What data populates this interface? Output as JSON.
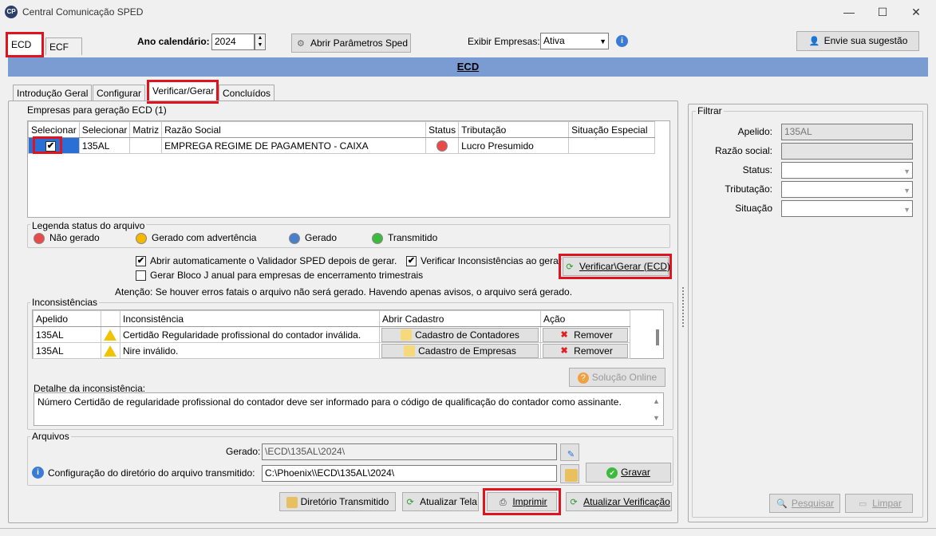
{
  "window": {
    "title": "Central Comunicação SPED",
    "app_icon": "CP",
    "min": "—",
    "max": "☐",
    "close": "✕"
  },
  "top_tabs": [
    {
      "label": "ECD"
    },
    {
      "label": "ECF"
    }
  ],
  "toolbar": {
    "ano_label": "Ano calendário:",
    "ano_value": "2024",
    "abrir_param": "Abrir Parâmetros Sped",
    "exibir_label": "Exibir Empresas:",
    "exibir_value": "Ativa",
    "sugestao": "Envie sua sugestão"
  },
  "banner": "ECD",
  "sub_tabs": [
    {
      "label": "Introdução Geral"
    },
    {
      "label": "Configurar"
    },
    {
      "label": "Verificar/Gerar"
    },
    {
      "label": "Concluídos"
    }
  ],
  "empresas": {
    "group_label": "Empresas para geração ECD (1)",
    "columns": [
      "Selecionar",
      "Selecionar",
      "Matriz",
      "Razão Social",
      "Status",
      "Tributação",
      "Situação Especial"
    ],
    "rows": [
      {
        "check": "✔",
        "apelido": "135AL",
        "matriz": "",
        "razao": "EMPREGA REGIME DE PAGAMENTO - CAIXA",
        "tributacao": "Lucro Presumido",
        "situacao": ""
      }
    ]
  },
  "legenda": {
    "label": "Legenda status do arquivo",
    "items": [
      {
        "label": "Não gerado",
        "color": "#e84a4a"
      },
      {
        "label": "Gerado com advertência",
        "color": "#f5b800"
      },
      {
        "label": "Gerado",
        "color": "#4a7fc9"
      },
      {
        "label": "Transmitido",
        "color": "#3cba3c"
      }
    ]
  },
  "options": {
    "abrir_validador": "Abrir automaticamente o Validador SPED depois de gerar.",
    "verificar_incons": "Verificar Inconsistências ao gerar",
    "gerar_bloco": "Gerar Bloco J anual para empresas de encerramento trimestrais",
    "verificar_btn": "Verificar\\Gerar (ECD)",
    "atencao": "Atenção: Se houver erros fatais o arquivo não será gerado. Havendo apenas avisos, o arquivo será gerado."
  },
  "inconsistencias": {
    "label": "Inconsistências",
    "columns": [
      "Apelido",
      "",
      "Inconsistência",
      "Abrir Cadastro",
      "Ação"
    ],
    "rows": [
      {
        "apelido": "135AL",
        "text": "Certidão Regularidade profissional do contador inválida.",
        "cadastro": "Cadastro de Contadores",
        "acao": "Remover"
      },
      {
        "apelido": "135AL",
        "text": "Nire inválido.",
        "cadastro": "Cadastro de Empresas",
        "acao": "Remover"
      }
    ],
    "solucao": "Solução Online",
    "detalhe_label": "Detalhe da inconsistência:",
    "detalhe_text": "Número Certidão de regularidade profissional do contador deve ser informado para o código de qualificação do contador como assinante."
  },
  "arquivos": {
    "label": "Arquivos",
    "gerado_label": "Gerado:",
    "gerado_value": "\\ECD\\135AL\\2024\\",
    "config_label": "Configuração do diretório do arquivo transmitido:",
    "config_value": "C:\\Phoenix\\\\ECD\\135AL\\2024\\",
    "gravar": "Gravar"
  },
  "bottom_buttons": {
    "diretorio": "Diretório Transmitido",
    "atualizar_tela": "Atualizar Tela",
    "imprimir": "Imprimir",
    "atualizar_verif": "Atualizar Verificação"
  },
  "filtrar": {
    "label": "Filtrar",
    "apelido_label": "Apelido:",
    "apelido_value": "135AL",
    "razao_label": "Razão social:",
    "status_label": "Status:",
    "tributacao_label": "Tributação:",
    "situacao_label": "Situação",
    "pesquisar": "Pesquisar",
    "limpar": "Limpar"
  }
}
